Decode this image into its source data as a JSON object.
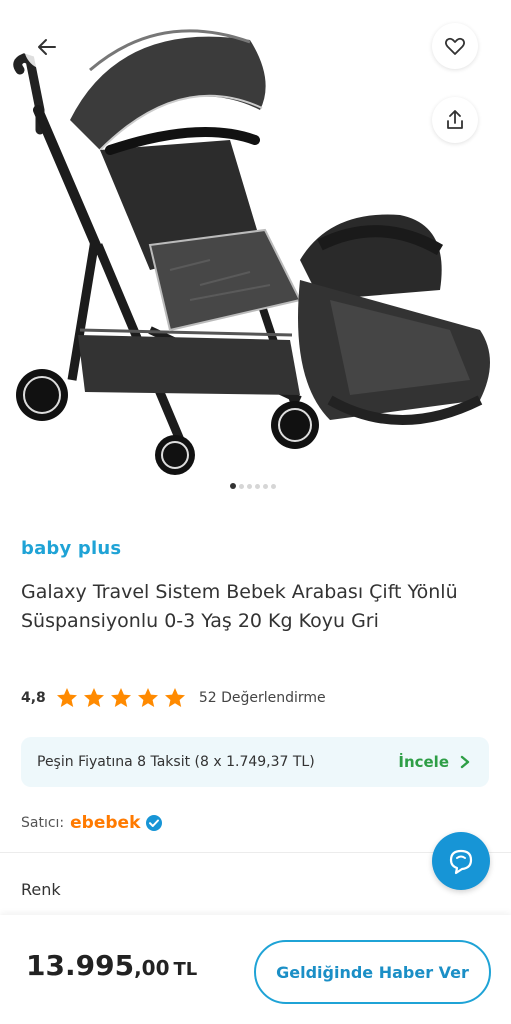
{
  "gallery": {
    "image_count": 6,
    "active_index": 0,
    "back_icon": "arrow-left-icon",
    "favorite_icon": "heart-outline-icon",
    "share_icon": "share-icon"
  },
  "product": {
    "brand": "baby plus",
    "title": "Galaxy Travel Sistem Bebek Arabası Çift Yönlü Süspansiyonlu 0-3 Yaş 20 Kg Koyu Gri",
    "rating": {
      "value": "4,8",
      "stars": 5,
      "count_label": "52 Değerlendirme"
    }
  },
  "installment": {
    "text": "Peşin Fiyatına 8 Taksit (8 x 1.749,37 TL)",
    "link_label": "İncele"
  },
  "seller": {
    "label": "Satıcı:",
    "name": "ebebek",
    "verified_icon": "verified-check-icon"
  },
  "variant": {
    "label": "Renk"
  },
  "bottom_bar": {
    "price_main": "13.995",
    "price_decimal": ",00",
    "currency": "TL",
    "action_label": "Geldiğinde Haber Ver"
  },
  "colors": {
    "brand_blue": "#1fa3d6",
    "star_orange": "#ff8a00",
    "link_green": "#2e9e46",
    "seller_orange": "#ff7a00",
    "fab_blue": "#1795d6"
  }
}
